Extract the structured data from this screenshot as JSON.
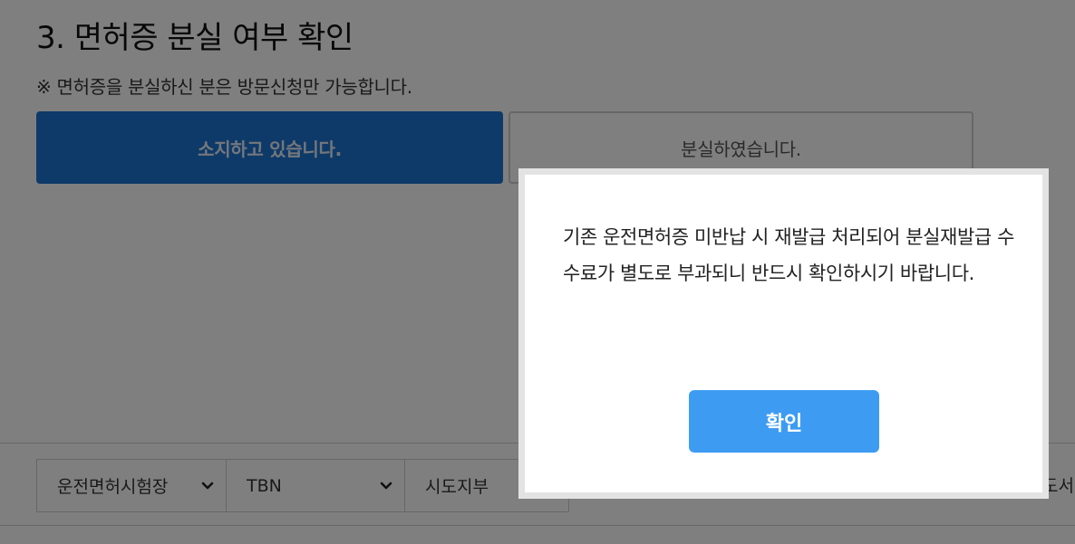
{
  "section": {
    "title": "3. 면허증 분실 여부 확인",
    "notice": "※ 면허증을 분실하신 분은 방문신청만 가능합니다."
  },
  "options": {
    "have_label": "소지하고 있습니다.",
    "lost_label": "분실하였습니다."
  },
  "footer": {
    "select_1": "운전면허시험장",
    "select_2": "TBN",
    "select_3": "시도지부",
    "edge_text": "도서실"
  },
  "modal": {
    "message": "기존 운전면허증 미반납 시 재발급 처리되어 분실재발급 수수료가 별도로 부과되니 반드시 확인하시기 바랍니다.",
    "confirm_label": "확인"
  },
  "icons": {
    "select_arrow": "chevron-down-icon"
  },
  "colors": {
    "primary_selected": "#1d74d3",
    "modal_button": "#3d9cf2",
    "overlay": "rgba(0,0,0,0.5)"
  }
}
